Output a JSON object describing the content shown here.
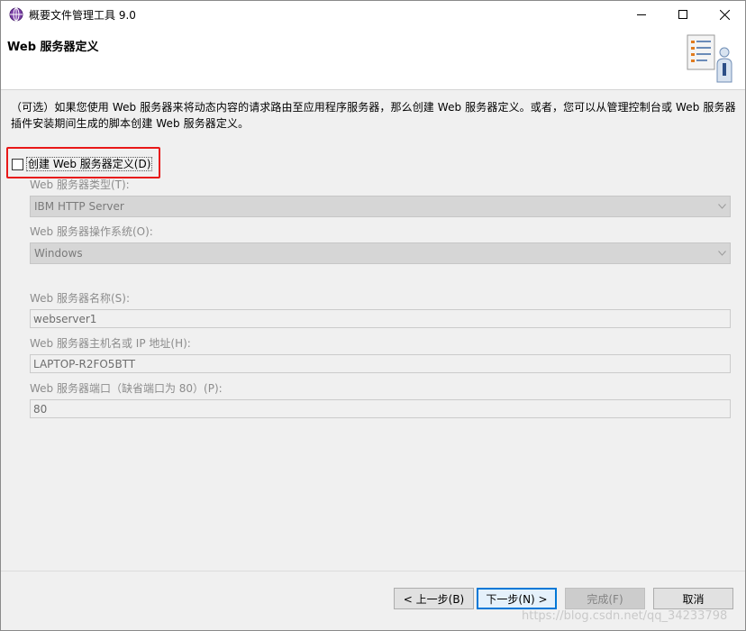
{
  "window": {
    "title": "概要文件管理工具 9.0"
  },
  "banner": {
    "title": "Web 服务器定义"
  },
  "description": {
    "line1": "（可选）如果您使用 Web 服务器来将动态内容的请求路由至应用程序服务器，那么创建 Web 服务器定义。或者，您可以从管理控制台或 Web 服务器",
    "line2": "插件安装期间生成的脚本创建 Web 服务器定义。"
  },
  "checkbox": {
    "label": "创建 Web 服务器定义(D)",
    "checked": false
  },
  "form": {
    "server_type_label": "Web 服务器类型(T):",
    "server_type_value": "IBM HTTP Server",
    "os_label": "Web 服务器操作系统(O):",
    "os_value": "Windows",
    "name_label": "Web 服务器名称(S):",
    "name_value": "webserver1",
    "host_label": "Web 服务器主机名或 IP 地址(H):",
    "host_value": "LAPTOP-R2FO5BTT",
    "port_label": "Web 服务器端口（缺省端口为 80）(P):",
    "port_value": "80"
  },
  "buttons": {
    "back": "< 上一步(B)",
    "next": "下一步(N) >",
    "finish": "完成(F)",
    "cancel": "取消"
  },
  "watermark": "https://blog.csdn.net/qq_34233798",
  "colors": {
    "highlight_frame": "#e81818",
    "default_button_border": "#0078d7"
  }
}
